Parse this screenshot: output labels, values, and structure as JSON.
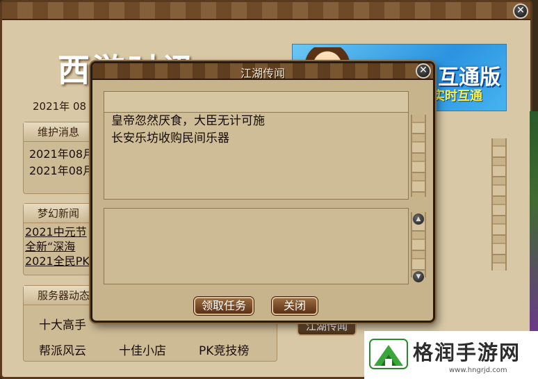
{
  "news_window": {
    "logo": "西游时讯",
    "date": "2021年  08",
    "maintenance": {
      "title": "维护消息",
      "items": [
        "2021年08月",
        "2021年08月"
      ]
    },
    "news": {
      "title": "梦幻新闻",
      "items": [
        "2021中元节",
        "全新“深海",
        "2021全民PK"
      ]
    },
    "server": {
      "title": "服务器动态",
      "links": [
        "十大高手",
        "",
        "",
        "帮派风云",
        "十佳小店",
        "PK竞技榜"
      ]
    },
    "banner": {
      "main_text": "互通版",
      "sub_text": "实时互通"
    },
    "jianghu_button": "江湖传闻"
  },
  "dialog": {
    "title": "江湖传闻",
    "rumors": [
      "皇帝忽然厌食，大臣无计可施",
      "长安乐坊收购民间乐器"
    ],
    "accept_button": "领取任务",
    "close_button": "关闭"
  },
  "watermark": {
    "title": "格润手游网",
    "url": "www.hngrjd.com"
  },
  "colors": {
    "parchment": "#c7b38c",
    "frame_brown": "#5e3e1e",
    "button_brown": "#9a6a42"
  }
}
